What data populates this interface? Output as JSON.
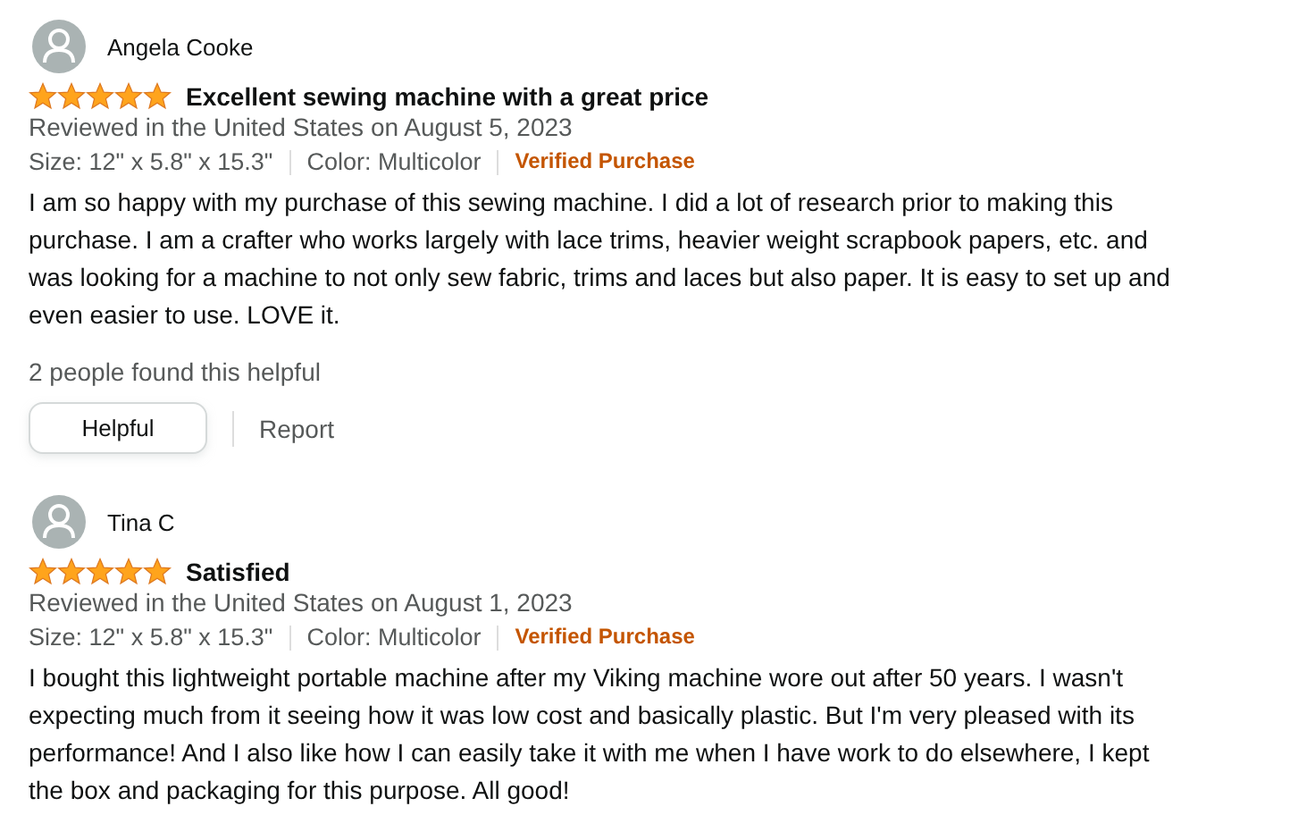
{
  "reviews": [
    {
      "author": "Angela Cooke",
      "stars": 5,
      "title": "Excellent sewing machine with a great price",
      "date": "Reviewed in the United States on August 5, 2023",
      "size": "Size: 12\" x 5.8\" x 15.3\"",
      "color_variant": "Color: Multicolor",
      "verified": "Verified Purchase",
      "body": "I am so happy with my purchase of this sewing machine. I did a lot of research prior to making this purchase. I am a crafter who works largely with lace trims, heavier weight scrapbook papers, etc. and was looking for a machine to not only sew fabric, trims and laces but also paper. It is easy to set up and even easier to use. LOVE it.",
      "helpful_count": "2 people found this helpful",
      "helpful_button": "Helpful",
      "report": "Report"
    },
    {
      "author": "Tina C",
      "stars": 5,
      "title": "Satisfied",
      "date": "Reviewed in the United States on August 1, 2023",
      "size": "Size: 12\" x 5.8\" x 15.3\"",
      "color_variant": "Color: Multicolor",
      "verified": "Verified Purchase",
      "body": "I bought this lightweight portable machine after my Viking machine wore out after 50 years. I wasn't expecting much from it seeing how it was low cost and basically plastic. But I'm very pleased with its performance! And I also like how I can easily take it with me when I have work to do elsewhere, I kept the box and packaging for this purpose. All good!"
    }
  ]
}
